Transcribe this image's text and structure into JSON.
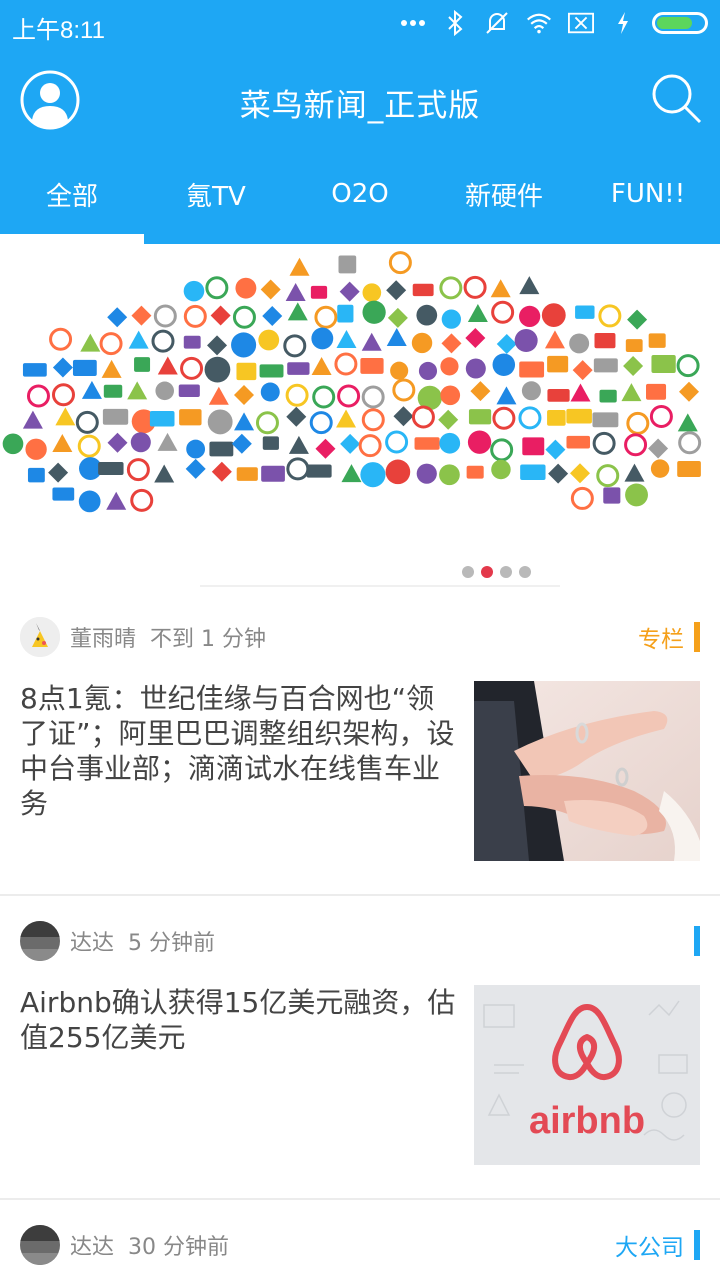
{
  "status_bar": {
    "time": "上午8:11"
  },
  "app_bar": {
    "title": "菜鸟新闻_正式版"
  },
  "tabs": [
    {
      "label": "全部"
    },
    {
      "label": "氪TV"
    },
    {
      "label": "O2O"
    },
    {
      "label": "新硬件"
    },
    {
      "label": "FUN!!"
    }
  ],
  "banner": {
    "page_count": 4,
    "active_index": 1
  },
  "news": [
    {
      "author": "董雨晴",
      "time_ago": "不到 1 分钟",
      "tag": "专栏",
      "tag_color": "#f5a01a",
      "headline": "8点1氪：世纪佳缘与百合网也“领了证”；阿里巴巴调整组织架构，设中台事业部；滴滴试水在线售车业务",
      "thumb_icon": "wedding-hands-image"
    },
    {
      "author": "达达",
      "time_ago": "5 分钟前",
      "tag": "",
      "tag_color": "#1ea7f4",
      "headline": "Airbnb确认获得15亿美元融资，估值255亿美元",
      "thumb_icon": "airbnb-logo-image",
      "thumb_logo_text": "airbnb"
    },
    {
      "author": "达达",
      "time_ago": "30 分钟前",
      "tag": "大公司",
      "tag_color": "#1ea7f4"
    }
  ],
  "colors": {
    "primary": "#1ea7f4",
    "active_dot": "#e3394b"
  }
}
